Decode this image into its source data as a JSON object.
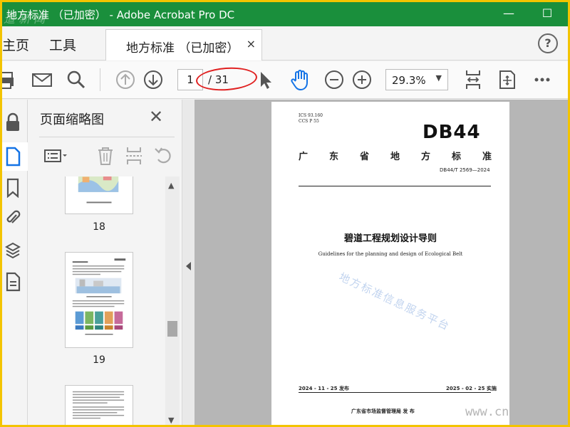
{
  "window": {
    "title": "地方标准 （已加密） - Adobe Acrobat Pro DC",
    "minimize": "—",
    "maximize": "☐"
  },
  "menu": {
    "home": "主页",
    "tools": "工具",
    "help": "?"
  },
  "doc_tab": {
    "label": "地方标准 （已加密）",
    "close": "×"
  },
  "toolbar": {
    "current_page": "1",
    "page_total": "/ 31",
    "zoom": "29.3%",
    "zoom_caret": "▼"
  },
  "panel": {
    "title": "页面缩略图",
    "close": "✕",
    "thumbnails": [
      {
        "number": "18"
      },
      {
        "number": "19"
      },
      {
        "number": ""
      }
    ]
  },
  "document": {
    "ics": "ICS  93.160",
    "ccs": "CCS  P 55",
    "badge": "DB44",
    "standard_type_chars": [
      "广",
      "东",
      "省",
      "地",
      "方",
      "标",
      "准"
    ],
    "code": "DB44/T 2569—2024",
    "title": "碧道工程规划设计导则",
    "subtitle": "Guidelines for the planning and design of Ecological Belt",
    "watermark": "地方标准信息服务平台",
    "publish_date": "2024 - 11 - 25 发布",
    "implement_date": "2025 - 02 - 25 实施",
    "issuer": "广东省市场监督管理局       发  布"
  },
  "corner_watermark": "www.cn",
  "colors": {
    "title_bar": "#1a8f3c",
    "outer_border": "#f3c400",
    "highlight_circle": "#e02020",
    "accent_blue": "#1473e6"
  }
}
